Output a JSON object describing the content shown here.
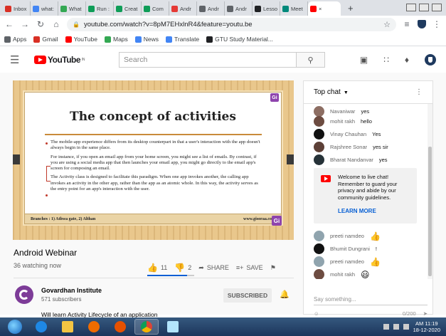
{
  "browser": {
    "tabs": [
      {
        "label": "Inbox",
        "color": "#d93025"
      },
      {
        "label": "what:",
        "color": "#4285f4"
      },
      {
        "label": "What",
        "color": "#34a853"
      },
      {
        "label": "Run :",
        "color": "#0f9d58"
      },
      {
        "label": "Creat",
        "color": "#0f9d58"
      },
      {
        "label": "Com",
        "color": "#0f9d58"
      },
      {
        "label": "Andr",
        "color": "#e53935"
      },
      {
        "label": "Andr",
        "color": "#5f6368"
      },
      {
        "label": "Andr",
        "color": "#5f6368"
      },
      {
        "label": "Lesso",
        "color": "#202124"
      },
      {
        "label": "Meet",
        "color": "#00897b"
      },
      {
        "label": "×",
        "color": "#ff0000"
      }
    ],
    "new_tab": "+",
    "url": "youtube.com/watch?v=8pM7EHxlnR4&feature=youtu.be",
    "bookmarks": [
      {
        "label": "Apps",
        "color": "#5f6368"
      },
      {
        "label": "Gmail",
        "color": "#d93025"
      },
      {
        "label": "YouTube",
        "color": "#ff0000"
      },
      {
        "label": "Maps",
        "color": "#34a853"
      },
      {
        "label": "News",
        "color": "#4285f4"
      },
      {
        "label": "Translate",
        "color": "#4285f4"
      },
      {
        "label": "GTU Study Material...",
        "color": "#202124"
      }
    ]
  },
  "youtube": {
    "logo_text": "YouTube",
    "logo_suffix": "IN",
    "search_placeholder": "Search"
  },
  "video": {
    "slide_title": "The concept of activities",
    "paragraphs": [
      "The mobile-app experience differs from its desktop counterpart in that a user's interaction with the app doesn't always begin in the same place.",
      "For instance, if you open an email app from your home screen, you might see a list of emails. By contrast, if you are using a social media app that then launches your email app, you might go directly to the email app's screen for composing an email.",
      "The Activity class is designed to facilitate this paradigm. When one app invokes another, the calling app invokes an activity in the other app, rather than the app as an atomic whole. In this way, the activity serves as the entry point for an app's interaction with the user."
    ],
    "footer_left": "Branches : 1) Athwa gate, 2) Althan",
    "footer_right": "www.gisoraa.com",
    "badge": "Gi",
    "title": "Android Webinar",
    "watching": "36 watching now",
    "likes": "11",
    "dislikes": "2",
    "share_label": "SHARE",
    "save_label": "SAVE",
    "like_ratio": 0.85
  },
  "channel": {
    "name": "Govardhan Institute",
    "subscribers": "571 subscribers",
    "subscribe_label": "SUBSCRIBED",
    "description": "Will learn Activity Lifecycle of an application"
  },
  "chat": {
    "header": "Top chat",
    "messages": [
      {
        "author": "Navaniwar",
        "text": "yes",
        "color": "#8d6e63"
      },
      {
        "author": "mohit rakh",
        "text": "hello",
        "color": "#6d4c41"
      },
      {
        "author": "Vinay Chauhan",
        "text": "Yes",
        "color": "#111111"
      },
      {
        "author": "Rajshree Sonar",
        "text": "yes sir",
        "color": "#5d4037"
      },
      {
        "author": "Bharat Nandanvar",
        "text": "yes",
        "color": "#263238"
      }
    ],
    "welcome_text": "Welcome to live chat! Remember to guard your privacy and abide by our community guidelines.",
    "learn_more": "LEARN MORE",
    "messages_after": [
      {
        "author": "preeti namdeo",
        "text": "👍",
        "color": "#90a4ae"
      },
      {
        "author": "Bhumit Dungrani",
        "text": "!",
        "color": "#111111"
      },
      {
        "author": "preeti namdeo",
        "text": "👍",
        "color": "#90a4ae"
      },
      {
        "author": "mohit rakh",
        "text": "😃",
        "color": "#6d4c41"
      }
    ],
    "input_placeholder": "Say something...",
    "char_count": "0/200"
  },
  "taskbar": {
    "time": "AM 11:19",
    "date": "18-12-2020"
  }
}
